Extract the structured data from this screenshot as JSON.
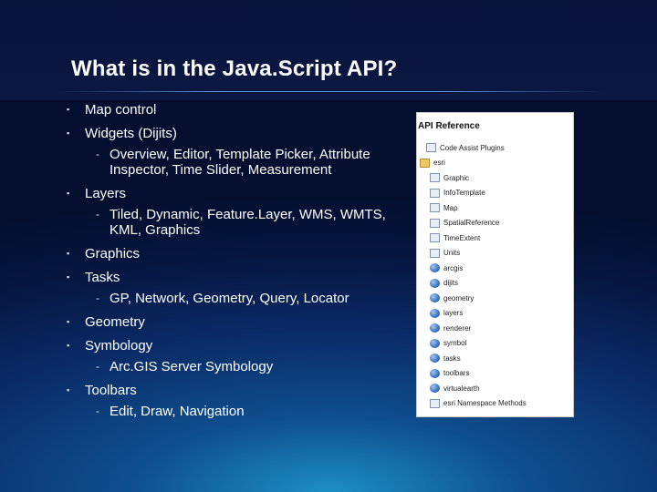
{
  "slide": {
    "title": "What is in the Java.Script API?",
    "bullets": [
      {
        "text": "Map control"
      },
      {
        "text": "Widgets (Dijits)",
        "sub": "Overview, Editor, Template Picker, Attribute Inspector, Time Slider, Measurement"
      },
      {
        "text": "Layers",
        "sub": "Tiled, Dynamic, Feature.Layer, WMS, WMTS, KML, Graphics"
      },
      {
        "text": "Graphics"
      },
      {
        "text": "Tasks",
        "sub": "GP, Network, Geometry, Query, Locator"
      },
      {
        "text": "Geometry"
      },
      {
        "text": "Symbology",
        "sub": "Arc.GIS Server Symbology"
      },
      {
        "text": "Toolbars",
        "sub": "Edit, Draw, Navigation"
      }
    ],
    "bullet_marker": "▪",
    "sub_marker": "-"
  },
  "api_reference": {
    "title": "API Reference",
    "items": [
      {
        "label": "Code Assist Plugins",
        "icon": "page-icon"
      },
      {
        "label": "esri",
        "icon": "folder-icon"
      },
      {
        "label": "Graphic",
        "icon": "page-icon"
      },
      {
        "label": "InfoTemplate",
        "icon": "page-icon"
      },
      {
        "label": "Map",
        "icon": "page-icon"
      },
      {
        "label": "SpatialReference",
        "icon": "page-icon"
      },
      {
        "label": "TimeExtent",
        "icon": "page-icon"
      },
      {
        "label": "Units",
        "icon": "page-icon"
      },
      {
        "label": "arcgis",
        "icon": "namespace-icon"
      },
      {
        "label": "dijits",
        "icon": "namespace-icon"
      },
      {
        "label": "geometry",
        "icon": "namespace-icon"
      },
      {
        "label": "layers",
        "icon": "namespace-icon"
      },
      {
        "label": "renderer",
        "icon": "namespace-icon"
      },
      {
        "label": "symbol",
        "icon": "namespace-icon"
      },
      {
        "label": "tasks",
        "icon": "namespace-icon"
      },
      {
        "label": "toolbars",
        "icon": "namespace-icon"
      },
      {
        "label": "virtualearth",
        "icon": "namespace-icon"
      },
      {
        "label": "esri Namespace Methods",
        "icon": "page-icon"
      }
    ]
  }
}
